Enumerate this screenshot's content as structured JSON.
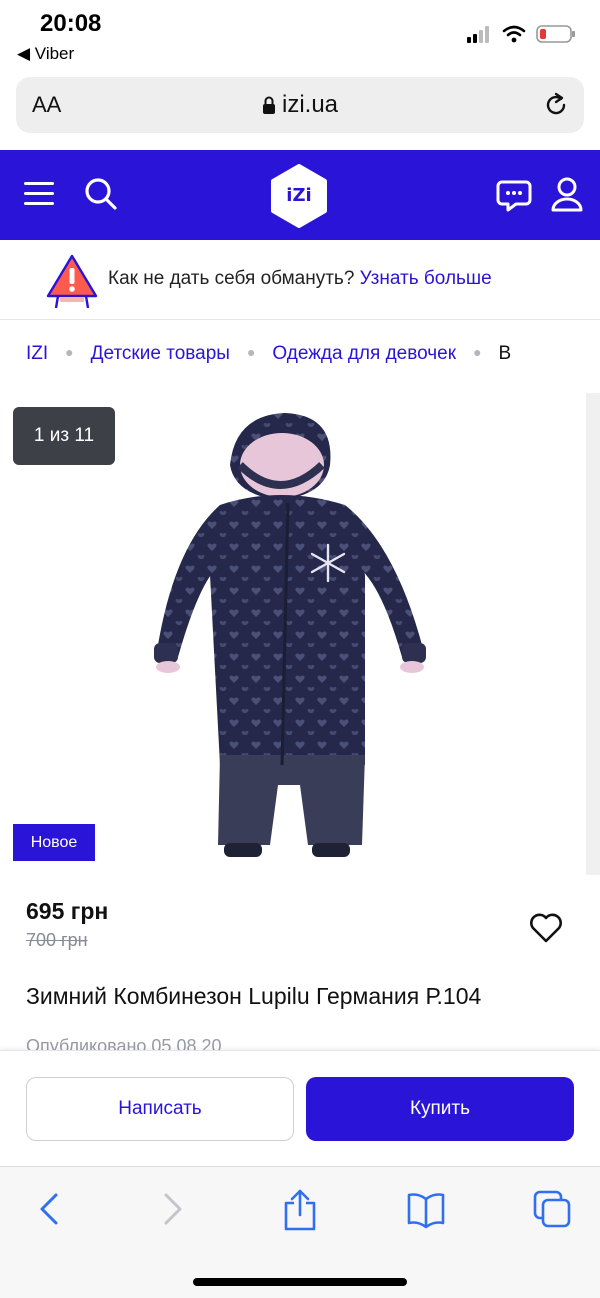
{
  "status": {
    "time": "20:08",
    "back_app": "◀ Viber"
  },
  "addressbar": {
    "text_size": "AA",
    "domain": "izi.ua"
  },
  "header": {
    "logo_text": "iZi",
    "brand_color": "#2a14d8"
  },
  "warning": {
    "text": "Как не дать себя обмануть?",
    "link": "Узнать больше"
  },
  "breadcrumbs": [
    "IZI",
    "Детские товары",
    "Одежда для девочек",
    "В"
  ],
  "gallery": {
    "counter": "1 из 11",
    "badge": "Новое"
  },
  "product": {
    "price": "695 грн",
    "old_price": "700 грн",
    "title": "Зимний Комбинезон Lupilu Германия Р.104",
    "posted": "Опубликовано 05.08.20"
  },
  "actions": {
    "write": "Написать",
    "buy": "Купить"
  }
}
